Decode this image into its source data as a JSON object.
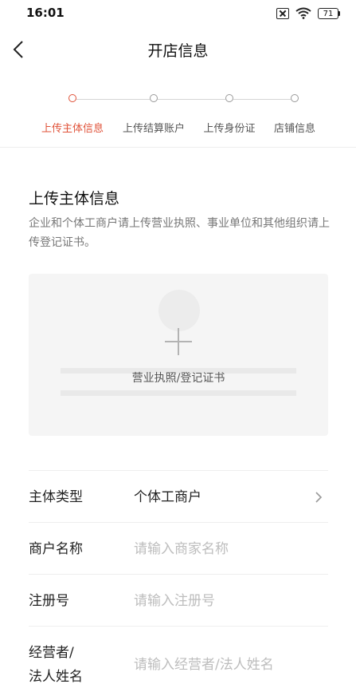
{
  "status": {
    "time": "16:01",
    "battery": "71"
  },
  "header": {
    "title": "开店信息"
  },
  "steps": [
    {
      "label": "上传主体信息",
      "active": true
    },
    {
      "label": "上传结算账户",
      "active": false
    },
    {
      "label": "上传身份证",
      "active": false
    },
    {
      "label": "店铺信息",
      "active": false
    }
  ],
  "section": {
    "title": "上传主体信息",
    "description": "企业和个体工商户请上传营业执照、事业单位和其他组织请上传登记证书。"
  },
  "upload": {
    "label": "营业执照/登记证书"
  },
  "form": {
    "entity_type": {
      "label": "主体类型",
      "value": "个体工商户"
    },
    "merchant_name": {
      "label": "商户名称",
      "placeholder": "请输入商家名称"
    },
    "registration_no": {
      "label": "注册号",
      "placeholder": "请输入注册号"
    },
    "operator_name": {
      "label_line1": "经营者/",
      "label_line2": "法人姓名",
      "placeholder": "请输入经营者/法人姓名"
    }
  },
  "colors": {
    "accent": "#e0533a",
    "placeholder": "#bdbdbd",
    "upload_bg": "#f5f5f5"
  }
}
